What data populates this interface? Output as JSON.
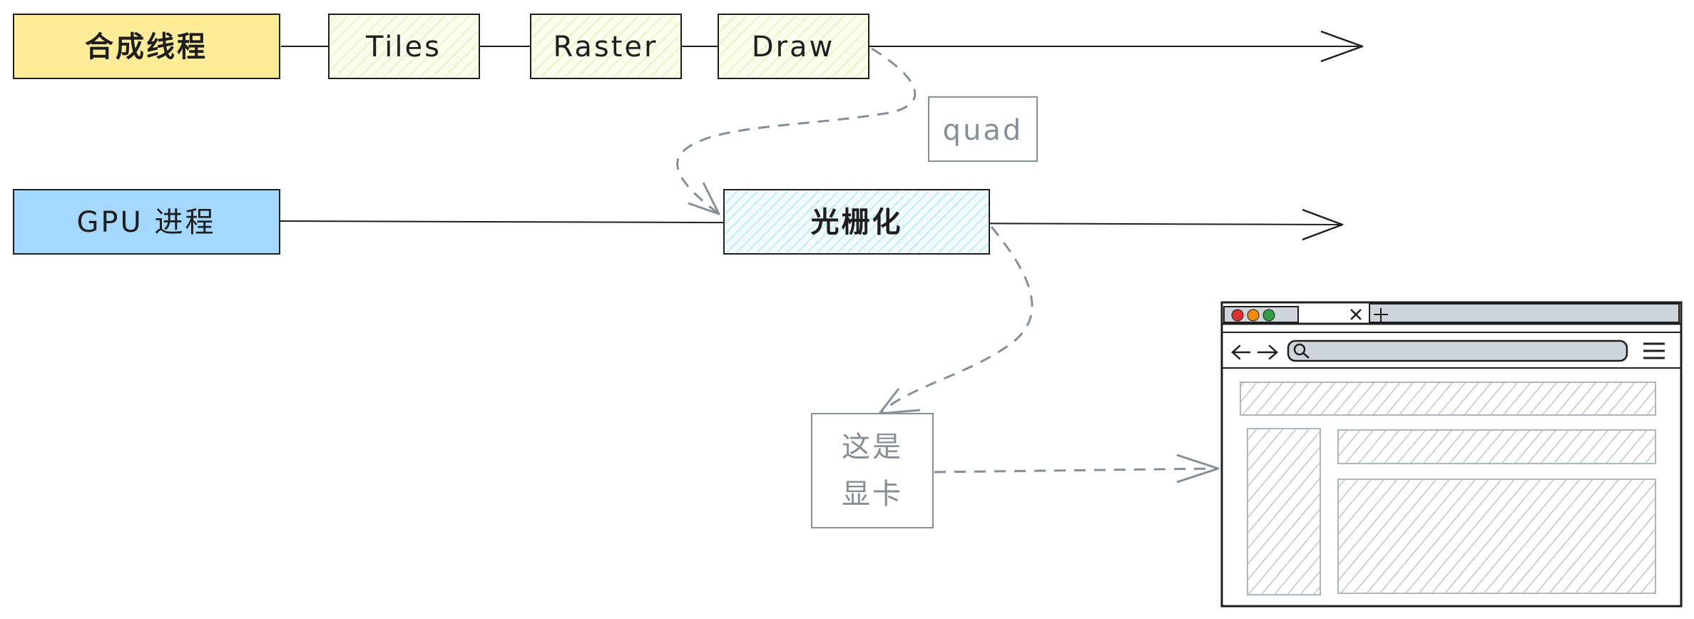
{
  "compositor_row": {
    "thread_label": "合成线程",
    "steps": [
      "Tiles",
      "Raster",
      "Draw"
    ]
  },
  "gpu_row": {
    "process_label": "GPU 进程",
    "raster_label": "光栅化"
  },
  "quad_label": "quad",
  "graphics_card_label": {
    "line1": "这是",
    "line2": "显卡"
  },
  "colors": {
    "compositor_fill": "#ffec99",
    "gpu_fill": "#a5d8ff",
    "step_hatch": "#e9f5c4",
    "raster_hatch": "#c3f0f5",
    "stroke": "#1e1e1e",
    "annotation": "#868e96",
    "browser_red": "#e03131",
    "browser_orange": "#f08c00",
    "browser_green": "#2f9e44"
  }
}
